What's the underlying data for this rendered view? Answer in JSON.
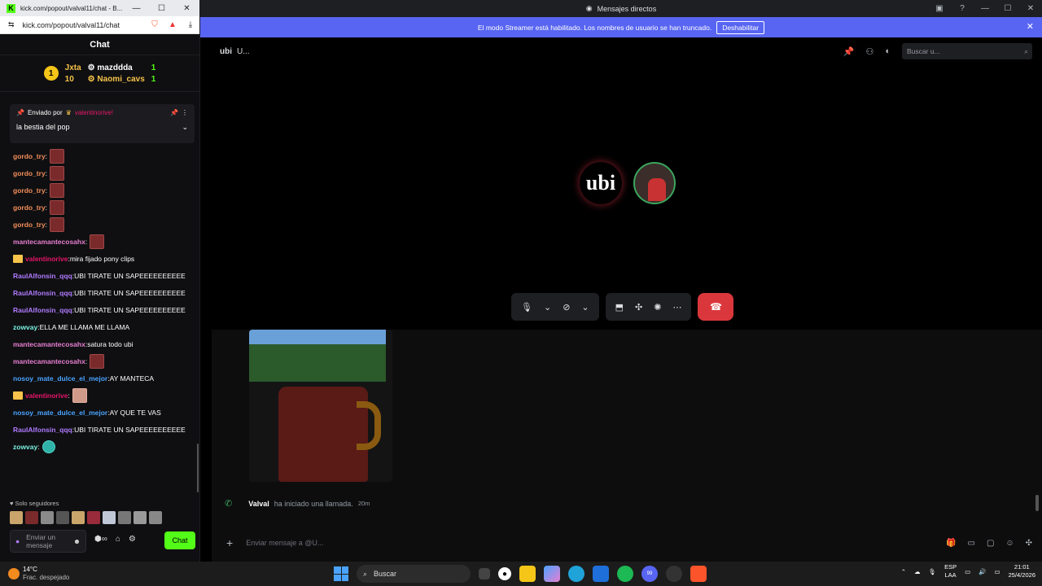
{
  "browser": {
    "title": "kick.com/popout/valval11/chat - B...",
    "url": "kick.com/popout/valval11/chat",
    "window_controls": [
      "—",
      "☐",
      "✕"
    ]
  },
  "kick": {
    "chat_header": "Chat",
    "leaderboard": {
      "rank": "1",
      "left_name": "Jxta",
      "left_count": "10",
      "right": [
        {
          "name": "mazddda",
          "count": "1"
        },
        {
          "name": "Naomi_cavs",
          "count": "1"
        }
      ]
    },
    "pinned": {
      "sent_by": "Enviado por",
      "sender": "valentinorive!",
      "text": "la bestia del pop"
    },
    "messages": [
      {
        "user": "gordo_try",
        "text": "",
        "emote": true,
        "color": "orange"
      },
      {
        "user": "gordo_try",
        "text": "",
        "emote": true,
        "color": "orange"
      },
      {
        "user": "gordo_try",
        "text": "",
        "emote": true,
        "color": "orange"
      },
      {
        "user": "gordo_try",
        "text": "",
        "emote": true,
        "color": "orange"
      },
      {
        "user": "gordo_try",
        "text": "",
        "emote": true,
        "color": "orange"
      },
      {
        "user": "mantecamantecosahx",
        "text": "",
        "emote": true,
        "color": "pink"
      },
      {
        "user": "valentinorive",
        "text": "mira fijado pony clips",
        "crown": true,
        "color": "red"
      },
      {
        "user": "RaulAlfonsin_qqq",
        "text": "UBI TIRATE UN SAPEEEEEEEEEE",
        "color": "purple"
      },
      {
        "user": "RaulAlfonsin_qqq",
        "text": "UBI TIRATE UN SAPEEEEEEEEEE",
        "color": "purple"
      },
      {
        "user": "RaulAlfonsin_qqq",
        "text": "UBI TIRATE UN SAPEEEEEEEEEE",
        "color": "purple"
      },
      {
        "user": "zowvay",
        "text": "ELLA ME LLAMA ME LLAMA",
        "color": "teal"
      },
      {
        "user": "mantecamantecosahx",
        "text": "satura todo ubi",
        "color": "pink"
      },
      {
        "user": "mantecamantecosahx",
        "text": "",
        "emote": true,
        "color": "pink"
      },
      {
        "user": "nosoy_mate_dulce_el_mejor",
        "text": "AY MANTECA",
        "color": "blue"
      },
      {
        "user": "valentinorive",
        "text": "",
        "crown": true,
        "emote": true,
        "color": "red"
      },
      {
        "user": "nosoy_mate_dulce_el_mejor",
        "text": "AY QUE TE VAS",
        "color": "blue"
      },
      {
        "user": "RaulAlfonsin_qqq",
        "text": "UBI TIRATE UN SAPEEEEEEEEEE",
        "color": "purple"
      },
      {
        "user": "zowvay",
        "text": "",
        "emote": true,
        "color": "teal"
      }
    ],
    "followers_only": "Solo seguidores",
    "input_placeholder": "Enviar un mensaje",
    "chat_button": "Chat"
  },
  "discord": {
    "window_title": "Mensajes directos",
    "banner_text": "El modo Streamer está habilitado. Los nombres de usuario se han truncado.",
    "banner_button": "Deshabilitar",
    "call_name": "U...",
    "search_placeholder": "Buscar u...",
    "avatar_text": "ubi",
    "call_message": {
      "user": "Valval",
      "action": "ha iniciado una llamada.",
      "time": "20m"
    },
    "input_placeholder": "Enviar mensaje a @U..."
  },
  "taskbar": {
    "weather_temp": "14°C",
    "weather_desc": "Frac. despejado",
    "search": "Buscar",
    "lang1": "ESP",
    "lang2": "LAA",
    "time": "21:01",
    "date": "25/4/2026",
    "notif_count": "99"
  },
  "colors": {
    "kick_green": "#53fc18",
    "discord_blurple": "#5865f2",
    "hangup_red": "#da373c"
  }
}
